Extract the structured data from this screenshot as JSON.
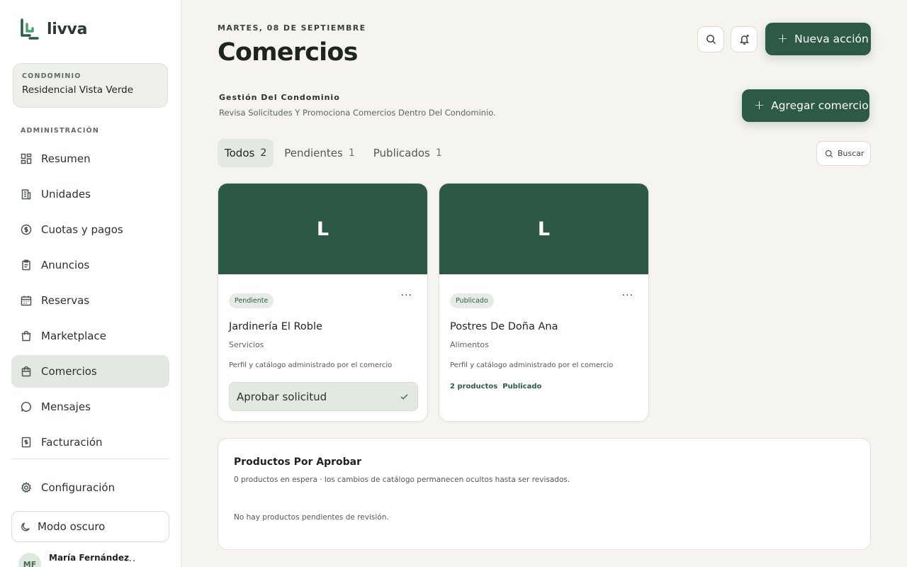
{
  "app": {
    "name": "livva"
  },
  "sidebar": {
    "condo_label": "CONDOMINIO",
    "condo_name": "Residencial Vista Verde",
    "section_label": "ADMINISTRACIÓN",
    "items": [
      {
        "label": "Resumen",
        "icon": "grid-icon"
      },
      {
        "label": "Unidades",
        "icon": "building-icon"
      },
      {
        "label": "Cuotas y pagos",
        "icon": "dollar-circle-icon"
      },
      {
        "label": "Anuncios",
        "icon": "clipboard-icon"
      },
      {
        "label": "Reservas",
        "icon": "calendar-icon"
      },
      {
        "label": "Marketplace",
        "icon": "shopping-bag-icon"
      },
      {
        "label": "Comercios",
        "icon": "store-bag-icon",
        "active": true
      },
      {
        "label": "Mensajes",
        "icon": "chat-icon"
      },
      {
        "label": "Facturación",
        "icon": "receipt-icon"
      }
    ],
    "settings_label": "Configuración",
    "dark_mode_label": "Modo oscuro",
    "user": {
      "initials": "MF",
      "name": "María Fernández"
    }
  },
  "header": {
    "date": "MARTES, 08 DE SEPTIEMBRE",
    "title": "Comercios",
    "new_action_label": "Nueva acción"
  },
  "management": {
    "title": "Gestión Del Condominio",
    "description": "Revisa Solicitudes Y Promociona Comercios Dentro Del Condominio.",
    "add_label": "Agregar comercio"
  },
  "tabs": [
    {
      "label": "Todos",
      "count": "2",
      "active": true
    },
    {
      "label": "Pendientes",
      "count": "1"
    },
    {
      "label": "Publicados",
      "count": "1"
    }
  ],
  "search": {
    "label": "Buscar"
  },
  "businesses": [
    {
      "initial": "L",
      "status": "Pendiente",
      "name": "Jardinería El Roble",
      "category": "Servicios",
      "description": "Perfil y catálogo administrado por el comercio",
      "action_label": "Aprobar solicitud"
    },
    {
      "initial": "L",
      "status": "Publicado",
      "name": "Postres De Doña Ana",
      "category": "Alimentos",
      "description": "Perfil y catálogo administrado por el comercio",
      "products": "2 productos",
      "published": "Publicado"
    }
  ],
  "products_panel": {
    "title": "Productos Por Aprobar",
    "subtitle": "0 productos en espera · los cambios de catálogo permanecen ocultos hasta ser revisados.",
    "empty": "No hay productos pendientes de revisión."
  },
  "colors": {
    "primary": "#2d5a45",
    "background": "#f5f4ef",
    "active_nav": "#e3e9e2",
    "banner": "#2d5846"
  }
}
